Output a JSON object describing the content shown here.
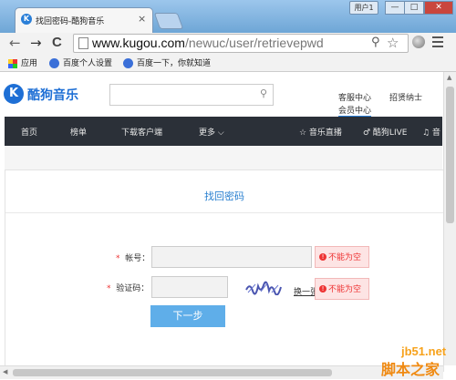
{
  "browser": {
    "tab_title": "找回密码-酷狗音乐",
    "tab_close": "×",
    "user_button": "用户1",
    "window_buttons": [
      "—",
      "□",
      "✕"
    ],
    "nav": {
      "back": "←",
      "forward": "→",
      "reload": "C"
    },
    "url_host": "www.kugou.com",
    "url_path": "/newuc/user/retrievepwd",
    "bookmarks": [
      "应用",
      "百度个人设置",
      "百度一下，你就知道"
    ]
  },
  "site": {
    "logo_letter": "K",
    "logo_text": "酷狗音乐",
    "header_links": [
      "客服中心",
      "招贤纳士"
    ],
    "vip_link": "会员中心",
    "nav": [
      "首页",
      "榜单",
      "下载客户端",
      "更多 ⌵",
      "☆ 音乐直播",
      "♂ 酷狗LIVE",
      "♫ 音"
    ]
  },
  "form": {
    "title": "找回密码",
    "required_mark": "*",
    "account_label": "帐号：",
    "captcha_label": "验证码：",
    "error_icon": "!",
    "account_error": "不能为空",
    "captcha_error": "不能为空",
    "refresh_link": "换一张",
    "next_button": "下一步"
  },
  "watermark": {
    "line1": "jb51.net",
    "line2": "脚本之家"
  }
}
